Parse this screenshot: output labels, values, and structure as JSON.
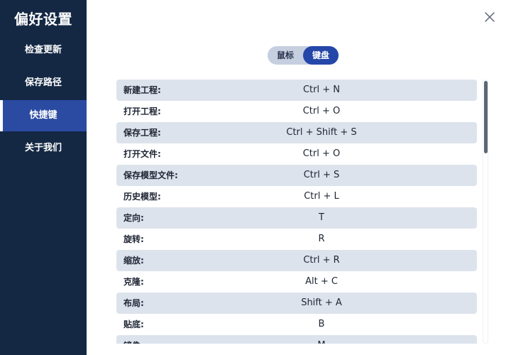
{
  "sidebar": {
    "title": "偏好设置",
    "items": [
      {
        "label": "检查更新"
      },
      {
        "label": "保存路径"
      },
      {
        "label": "快捷键"
      },
      {
        "label": "关于我们"
      }
    ],
    "active_index": 2
  },
  "mode_toggle": {
    "mouse_label": "鼠标",
    "keyboard_label": "键盘",
    "selected": "keyboard"
  },
  "shortcuts": [
    {
      "name": "新建工程:",
      "keys": "Ctrl + N"
    },
    {
      "name": "打开工程:",
      "keys": "Ctrl + O"
    },
    {
      "name": "保存工程:",
      "keys": "Ctrl + Shift + S"
    },
    {
      "name": "打开文件:",
      "keys": "Ctrl + O"
    },
    {
      "name": "保存模型文件:",
      "keys": "Ctrl + S"
    },
    {
      "name": "历史模型:",
      "keys": "Ctrl + L"
    },
    {
      "name": "定向:",
      "keys": "T"
    },
    {
      "name": "旋转:",
      "keys": "R"
    },
    {
      "name": "缩放:",
      "keys": "Ctrl + R"
    },
    {
      "name": "克隆:",
      "keys": "Alt + C"
    },
    {
      "name": "布局:",
      "keys": "Shift + A"
    },
    {
      "name": "贴底:",
      "keys": "B"
    },
    {
      "name": "镜像:",
      "keys": "M"
    }
  ],
  "colors": {
    "sidebar_bg": "#142844",
    "active_nav": "#2b4ba3",
    "row_alt": "#dde3ec",
    "toggle_active": "#2447a8"
  },
  "icons": {
    "close": "close-icon"
  }
}
